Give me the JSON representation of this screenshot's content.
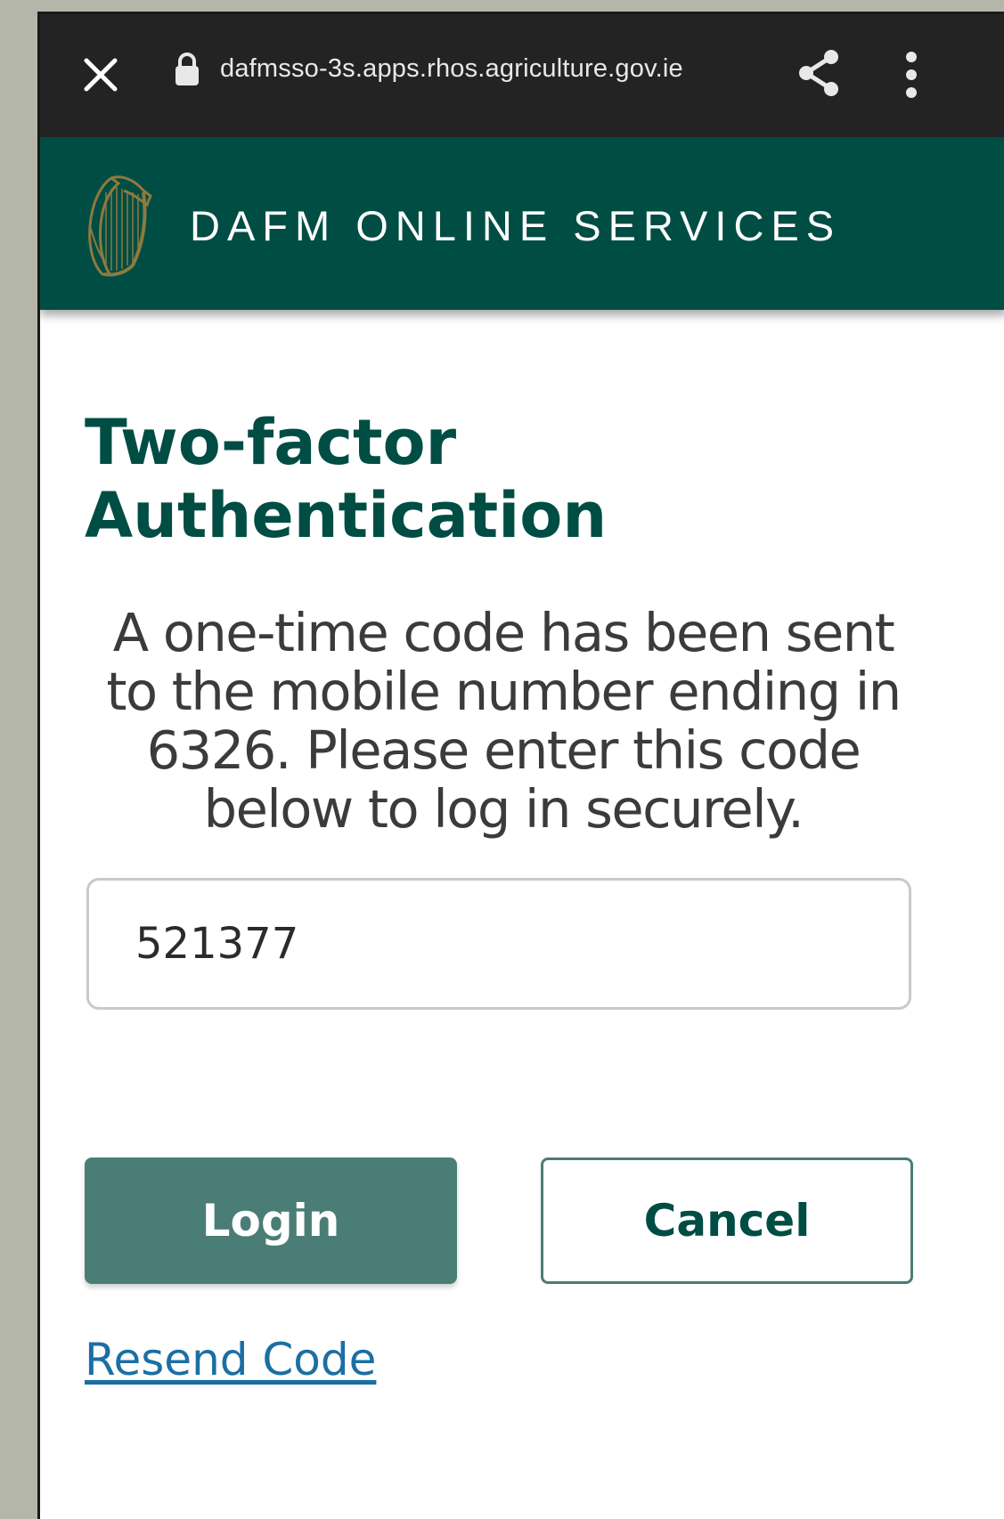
{
  "browser": {
    "url": "dafmsso-3s.apps.rhos.agriculture.gov.ie",
    "close_icon": "close-icon",
    "lock_icon": "lock-icon",
    "share_icon": "share-icon",
    "menu_icon": "more-vertical-icon"
  },
  "header": {
    "title": "DAFM ONLINE SERVICES",
    "logo": "harp-logo",
    "background_color": "#004d44"
  },
  "main": {
    "heading_line1": "Two-factor",
    "heading_line2": "Authentication",
    "message": "A one-time code has been sent to the mobile number ending in 6326. Please enter this code below to log in securely.",
    "code_value": "521377",
    "login_label": "Login",
    "cancel_label": "Cancel",
    "resend_label": "Resend Code"
  },
  "colors": {
    "accent": "#004d44",
    "button": "#4a7d76",
    "link": "#1a6fa3"
  }
}
